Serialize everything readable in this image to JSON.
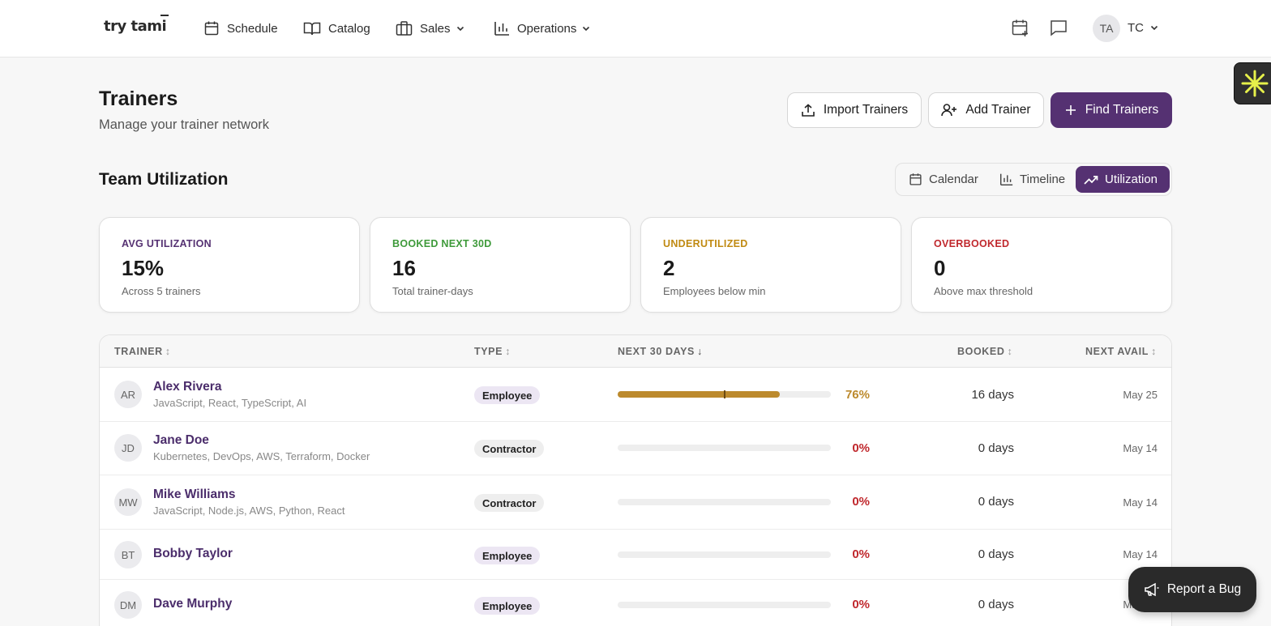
{
  "brand": {
    "logo_text": "try tami"
  },
  "nav": {
    "schedule": "Schedule",
    "catalog": "Catalog",
    "sales": "Sales",
    "operations": "Operations"
  },
  "user": {
    "avatar_initials": "TA",
    "initials": "TC"
  },
  "header": {
    "title": "Trainers",
    "subtitle": "Manage your trainer network",
    "import_label": "Import Trainers",
    "add_label": "Add Trainer",
    "find_label": "Find Trainers"
  },
  "section": {
    "title": "Team Utilization"
  },
  "views": {
    "calendar": "Calendar",
    "timeline": "Timeline",
    "utilization": "Utilization",
    "active": "utilization"
  },
  "stats": [
    {
      "label": "AVG UTILIZATION",
      "value": "15%",
      "note": "Across 5 trainers",
      "color": "#553172"
    },
    {
      "label": "BOOKED NEXT 30D",
      "value": "16",
      "note": "Total trainer-days",
      "color": "#3e9a3a"
    },
    {
      "label": "UNDERUTILIZED",
      "value": "2",
      "note": "Employees below min",
      "color": "#c08a12"
    },
    {
      "label": "OVERBOOKED",
      "value": "0",
      "note": "Above max threshold",
      "color": "#c0282d"
    }
  ],
  "table": {
    "headers": {
      "trainer": "TRAINER",
      "type": "TYPE",
      "next30": "NEXT 30 DAYS",
      "booked": "BOOKED",
      "next_avail": "NEXT AVAIL"
    },
    "rows": [
      {
        "initials": "AR",
        "name": "Alex Rivera",
        "skills": "JavaScript, React, TypeScript, AI",
        "type": "Employee",
        "utilization": 0.76,
        "pct": "76%",
        "pct_color": "#bc8a2d",
        "booked": "16 days",
        "next_avail": "May 25"
      },
      {
        "initials": "JD",
        "name": "Jane Doe",
        "skills": "Kubernetes, DevOps, AWS, Terraform, Docker",
        "type": "Contractor",
        "utilization": 0,
        "pct": "0%",
        "pct_color": "#c0282d",
        "booked": "0 days",
        "next_avail": "May 14"
      },
      {
        "initials": "MW",
        "name": "Mike Williams",
        "skills": "JavaScript, Node.js, AWS, Python, React",
        "type": "Contractor",
        "utilization": 0,
        "pct": "0%",
        "pct_color": "#c0282d",
        "booked": "0 days",
        "next_avail": "May 14"
      },
      {
        "initials": "BT",
        "name": "Bobby Taylor",
        "skills": "",
        "type": "Employee",
        "utilization": 0,
        "pct": "0%",
        "pct_color": "#c0282d",
        "booked": "0 days",
        "next_avail": "May 14"
      },
      {
        "initials": "DM",
        "name": "Dave Murphy",
        "skills": "",
        "type": "Employee",
        "utilization": 0,
        "pct": "0%",
        "pct_color": "#c0282d",
        "booked": "0 days",
        "next_avail": "May 14"
      }
    ]
  },
  "report_bug": "Report a Bug",
  "colors": {
    "brand": "#553172",
    "accent_gold": "#bc8a2d",
    "danger": "#c0282d"
  }
}
